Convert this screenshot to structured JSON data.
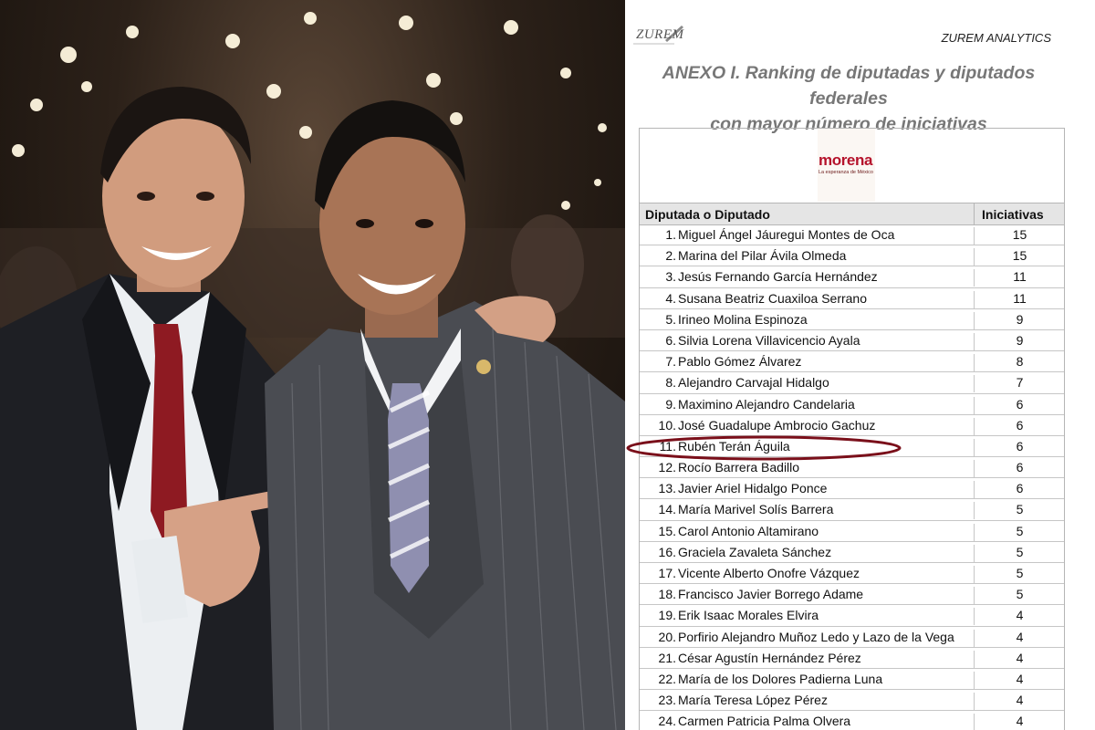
{
  "header": {
    "logo_text": "ZUREM",
    "brand": "ZUREM ANALYTICS",
    "title_line1": "ANEXO I. Ranking de diputadas y diputados federales",
    "title_line2": "con mayor número de iniciativas"
  },
  "party": {
    "name": "morena",
    "tagline": "La esperanza de México"
  },
  "table": {
    "col_name": "Diputada o Diputado",
    "col_count": "Iniciativas",
    "rows": [
      {
        "rank": "1.",
        "name": "Miguel Ángel Jáuregui Montes de Oca",
        "count": "15"
      },
      {
        "rank": "2.",
        "name": "Marina del Pilar Ávila Olmeda",
        "count": "15"
      },
      {
        "rank": "3.",
        "name": "Jesús Fernando García Hernández",
        "count": "11"
      },
      {
        "rank": "4.",
        "name": "Susana Beatriz Cuaxiloa Serrano",
        "count": "11"
      },
      {
        "rank": "5.",
        "name": "Irineo Molina Espinoza",
        "count": "9"
      },
      {
        "rank": "6.",
        "name": "Silvia Lorena Villavicencio Ayala",
        "count": "9"
      },
      {
        "rank": "7.",
        "name": "Pablo Gómez Álvarez",
        "count": "8"
      },
      {
        "rank": "8.",
        "name": "Alejandro Carvajal Hidalgo",
        "count": "7"
      },
      {
        "rank": "9.",
        "name": "Maximino Alejandro Candelaria",
        "count": "6"
      },
      {
        "rank": "10.",
        "name": "José Guadalupe Ambrocio Gachuz",
        "count": "6"
      },
      {
        "rank": "11.",
        "name": "Rubén Terán Águila",
        "count": "6"
      },
      {
        "rank": "12.",
        "name": "Rocío Barrera Badillo",
        "count": "6"
      },
      {
        "rank": "13.",
        "name": "Javier Ariel Hidalgo Ponce",
        "count": "6"
      },
      {
        "rank": "14.",
        "name": "María Marivel Solís Barrera",
        "count": "5"
      },
      {
        "rank": "15.",
        "name": "Carol Antonio Altamirano",
        "count": "5"
      },
      {
        "rank": "16.",
        "name": "Graciela Zavaleta Sánchez",
        "count": "5"
      },
      {
        "rank": "17.",
        "name": "Vicente Alberto Onofre Vázquez",
        "count": "5"
      },
      {
        "rank": "18.",
        "name": "Francisco Javier Borrego Adame",
        "count": "5"
      },
      {
        "rank": "19.",
        "name": "Erik Isaac Morales Elvira",
        "count": "4"
      },
      {
        "rank": "20.",
        "name": "Porfirio Alejandro Muñoz Ledo y Lazo de la Vega",
        "count": "4"
      },
      {
        "rank": "21.",
        "name": "César Agustín Hernández Pérez",
        "count": "4"
      },
      {
        "rank": "22.",
        "name": "María de los Dolores Padierna Luna",
        "count": "4"
      },
      {
        "rank": "23.",
        "name": "María Teresa López Pérez",
        "count": "4"
      },
      {
        "rank": "24.",
        "name": "Carmen Patricia Palma Olvera",
        "count": "4"
      }
    ]
  },
  "highlighted_row_rank": "11.",
  "colors": {
    "highlight_ellipse": "#7a0f1a",
    "party_red": "#b5122b",
    "header_gray": "#e5e5e5"
  }
}
